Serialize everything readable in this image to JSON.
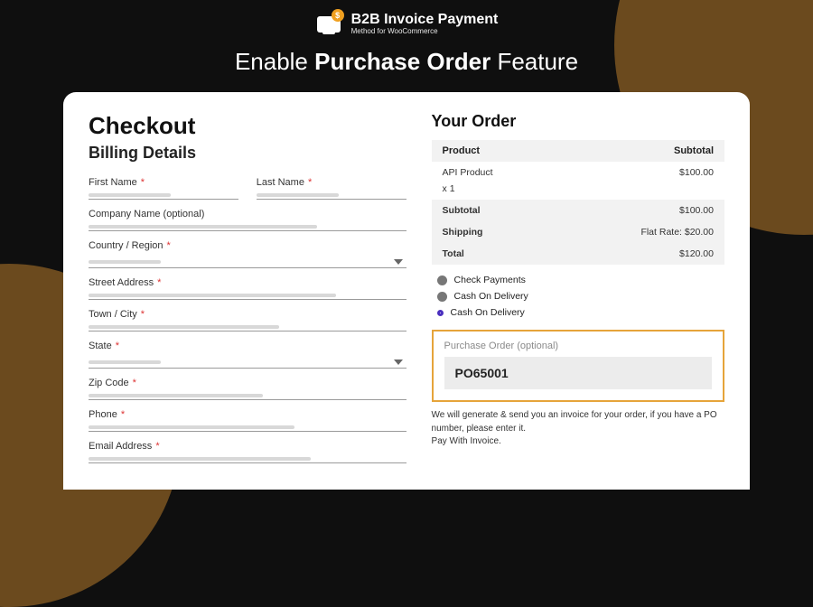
{
  "brand": {
    "title": "B2B Invoice Payment",
    "subtitle": "Method for WooCommerce"
  },
  "headline": {
    "pre": "Enable ",
    "strong": "Purchase Order",
    "post": " Feature"
  },
  "checkout_title": "Checkout",
  "billing_title": "Billing Details",
  "fields": {
    "first_name": "First Name",
    "last_name": "Last Name",
    "company": "Company Name (optional)",
    "country": "Country / Region",
    "street": "Street Address",
    "town": "Town / City",
    "state": "State",
    "zip": "Zip Code",
    "phone": "Phone",
    "email": "Email Address"
  },
  "order": {
    "title": "Your Order",
    "head_product": "Product",
    "head_subtotal": "Subtotal",
    "item_name": "API Product",
    "item_qty": "x 1",
    "item_price": "$100.00",
    "subtotal_label": "Subtotal",
    "subtotal_value": "$100.00",
    "shipping_label": "Shipping",
    "shipping_value": "Flat Rate: $20.00",
    "total_label": "Total",
    "total_value": "$120.00"
  },
  "payments": {
    "opt1": "Check Payments",
    "opt2": "Cash On Delivery",
    "opt3": "Cash On Delivery"
  },
  "po": {
    "label": "Purchase Order (optional)",
    "value": "PO65001",
    "desc1": "We will generate & send you an invoice for your order, if you have a PO number, please enter it.",
    "desc2": "Pay With Invoice."
  }
}
